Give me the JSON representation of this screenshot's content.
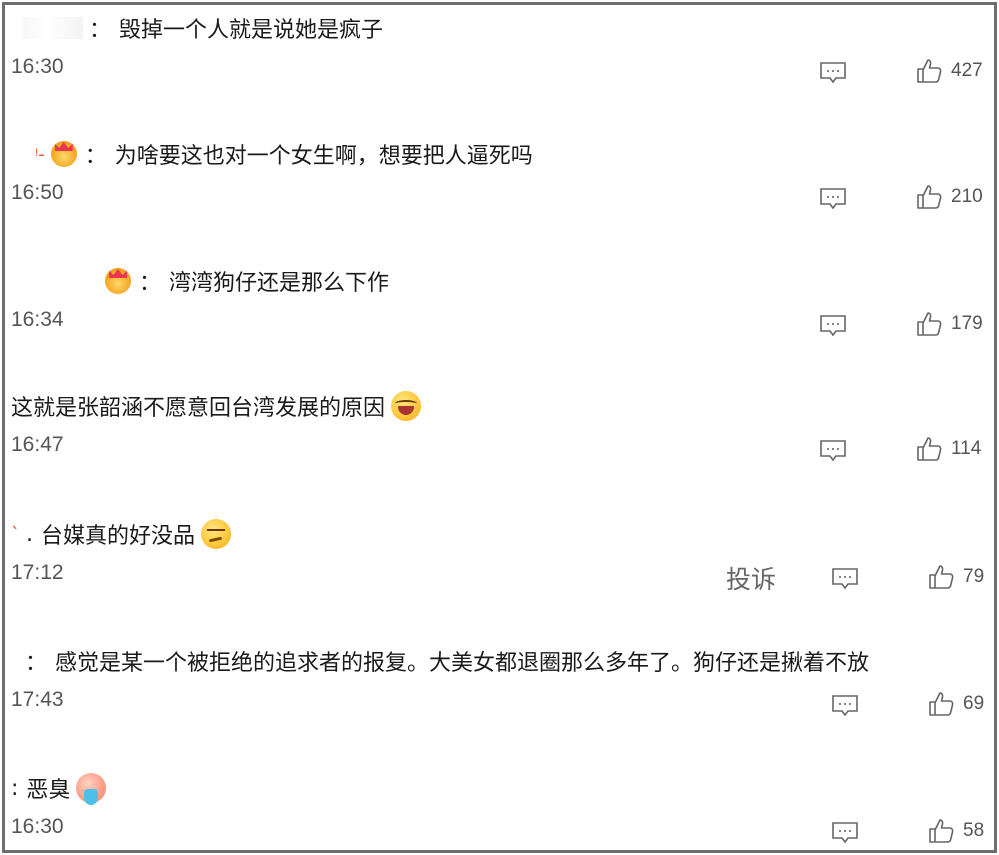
{
  "comments": [
    {
      "name_style": "masked",
      "separator": "：",
      "text": "毁掉一个人就是说她是疯子",
      "time": "16:30",
      "likes": "427"
    },
    {
      "name_style": "mark-crown",
      "name_mark": "ᵎ-",
      "separator": "：",
      "text": "为啥要这也对一个女生啊，想要把人逼死吗",
      "time": "16:50",
      "likes": "210"
    },
    {
      "name_style": "crown",
      "separator": "：",
      "text": "湾湾狗仔还是那么下作",
      "time": "16:34",
      "likes": "179"
    },
    {
      "name_style": "none",
      "text": "这就是张韶涵不愿意回台湾发展的原因",
      "emoji": "laugh-cry-emoji",
      "time": "16:47",
      "likes": "114"
    },
    {
      "name_style": "mark",
      "name_mark": "`",
      "separator": ".",
      "text": "台媒真的好没品",
      "emoji": "thinking-emoji",
      "time": "17:12",
      "report_label": "投诉",
      "likes": "79"
    },
    {
      "name_style": "colon",
      "separator": "：",
      "text": "感觉是某一个被拒绝的追求者的报复。大美女都退圈那么多年了。狗仔还是揪着不放",
      "time": "17:43",
      "likes": "69"
    },
    {
      "name_style": "colon",
      "separator": ":",
      "text": "恶臭",
      "emoji": "vomit-emoji",
      "time": "16:30",
      "likes": "58"
    }
  ],
  "icons": {
    "reply": "reply-icon",
    "like": "thumbs-up-icon"
  },
  "colors": {
    "frame_border": "#6e6e6e",
    "text": "#1a1a1a",
    "meta": "#555555"
  }
}
